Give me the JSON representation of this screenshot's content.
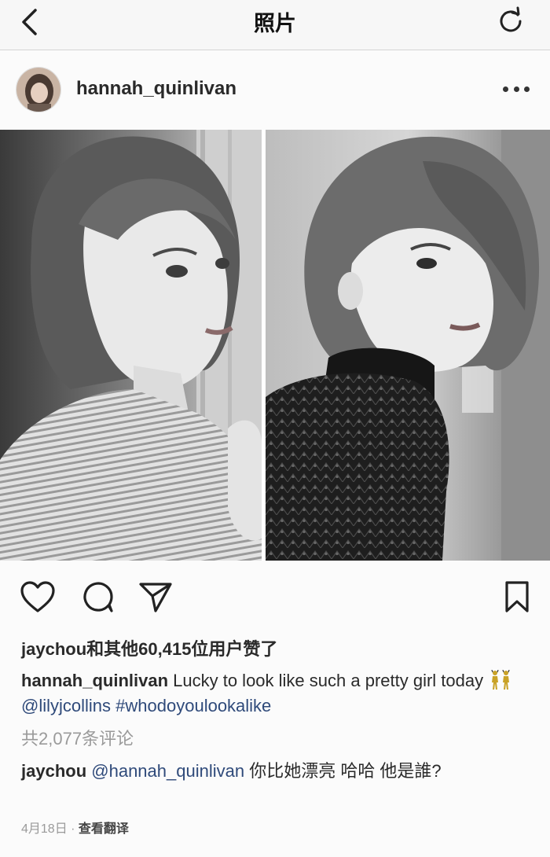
{
  "navbar": {
    "title": "照片"
  },
  "post": {
    "username": "hannah_quinlivan",
    "likes": {
      "user": "jaychou",
      "text": "和其他60,415位用户赞了"
    },
    "caption": {
      "user": "hannah_quinlivan",
      "text": " Lucky to look like such a pretty girl today",
      "mention": "@lilyjcollins",
      "hashtag": "#whodoyoulookalike"
    },
    "comments_count": "共2,077条评论",
    "comment": {
      "user": "jaychou",
      "mention": "@hannah_quinlivan",
      "text": " 你比她漂亮 哈哈 他是誰?"
    },
    "date": "4月18日",
    "separator": " · ",
    "translate": "查看翻译"
  },
  "icons": {
    "back": "chevron-left-icon",
    "refresh": "refresh-icon",
    "more": "more-dots-icon",
    "like": "heart-icon",
    "comment": "comment-bubble-icon",
    "share": "paper-plane-icon",
    "save": "bookmark-icon"
  },
  "colors": {
    "link": "#2f4a7a",
    "muted": "#9a9a9a",
    "text": "#2a2a2a"
  }
}
